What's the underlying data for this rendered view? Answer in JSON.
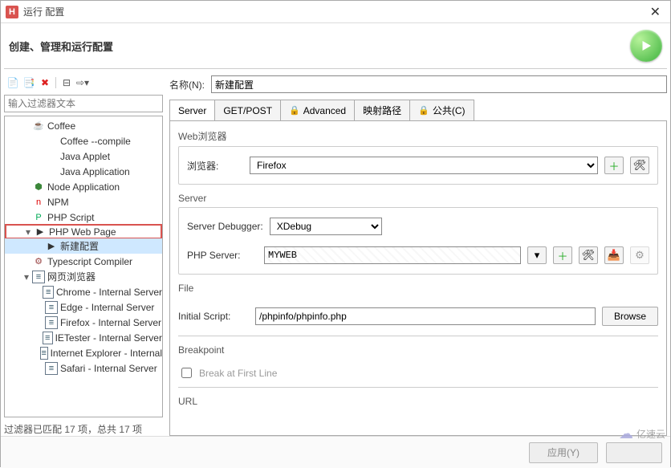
{
  "window": {
    "title": "运行 配置"
  },
  "subtitle": "创建、管理和运行配置",
  "filter_placeholder": "输入过滤器文本",
  "tree": {
    "items": [
      {
        "label": "Coffee",
        "depth": 1,
        "exp": "",
        "icon": "coffee"
      },
      {
        "label": "Coffee --compile",
        "depth": 2,
        "exp": "",
        "icon": ""
      },
      {
        "label": "Java Applet",
        "depth": 2,
        "exp": "",
        "icon": ""
      },
      {
        "label": "Java Application",
        "depth": 2,
        "exp": "",
        "icon": ""
      },
      {
        "label": "Node Application",
        "depth": 1,
        "exp": "",
        "icon": "node"
      },
      {
        "label": "NPM",
        "depth": 1,
        "exp": "",
        "icon": "npm"
      },
      {
        "label": "PHP Script",
        "depth": 1,
        "exp": "",
        "icon": "php"
      },
      {
        "label": "PHP Web Page",
        "depth": 1,
        "exp": "▾",
        "icon": "run",
        "selected": true
      },
      {
        "label": "新建配置",
        "depth": 2,
        "exp": "",
        "icon": "run",
        "highlight": true
      },
      {
        "label": "Typescript Compiler",
        "depth": 1,
        "exp": "",
        "icon": "gear"
      },
      {
        "label": "网页浏览器",
        "depth": 1,
        "exp": "▾",
        "icon": "page"
      },
      {
        "label": "Chrome - Internal Server",
        "depth": 2,
        "exp": "",
        "icon": "page"
      },
      {
        "label": "Edge - Internal Server",
        "depth": 2,
        "exp": "",
        "icon": "page"
      },
      {
        "label": "Firefox - Internal Server",
        "depth": 2,
        "exp": "",
        "icon": "page"
      },
      {
        "label": "IETester - Internal Server",
        "depth": 2,
        "exp": "",
        "icon": "page"
      },
      {
        "label": "Internet Explorer - Internal",
        "depth": 2,
        "exp": "",
        "icon": "page"
      },
      {
        "label": "Safari - Internal Server",
        "depth": 2,
        "exp": "",
        "icon": "page"
      }
    ]
  },
  "status": "过滤器已匹配 17 项，总共 17 项",
  "form": {
    "name_label": "名称(N):",
    "name_value": "新建配置",
    "tabs": [
      "Server",
      "GET/POST",
      "Advanced",
      "映射路径",
      "公共(C)"
    ],
    "active_tab": 0,
    "web_browser": {
      "group": "Web浏览器",
      "label": "浏览器:",
      "value": "Firefox"
    },
    "server": {
      "group": "Server",
      "debugger_label": "Server Debugger:",
      "debugger_value": "XDebug",
      "server_label": "PHP Server:",
      "server_value": "MYWEB"
    },
    "file": {
      "group": "File",
      "script_label": "Initial Script:",
      "script_value": "/phpinfo/phpinfo.php",
      "browse": "Browse"
    },
    "breakpoint": {
      "group": "Breakpoint",
      "check_label": "Break at First Line"
    },
    "url_group": "URL"
  },
  "footer": {
    "apply": "应用(Y)"
  },
  "watermark": "亿速云"
}
